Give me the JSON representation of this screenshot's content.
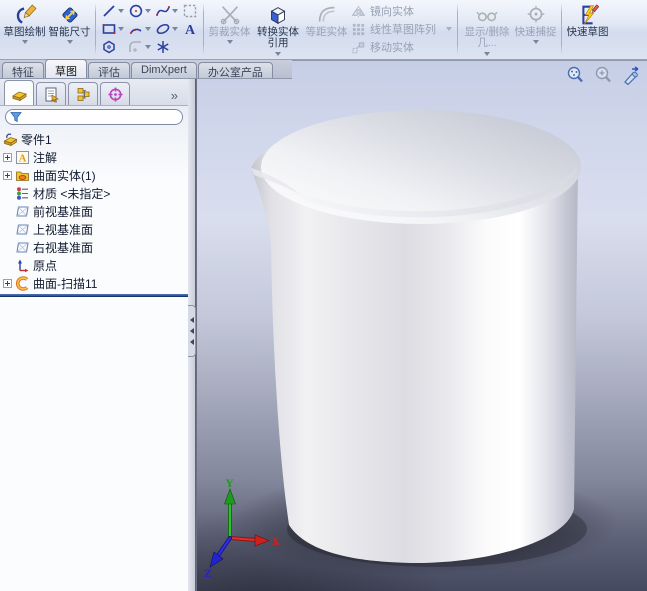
{
  "toolbar": {
    "sketch": "草图绘制",
    "smart_dimension": "智能尺寸",
    "trim": "剪裁实体",
    "convert_entities": "转换实体引用",
    "offset_entities": "等距实体",
    "mirror_entities": "镜向实体",
    "linear_pattern": "线性草图阵列",
    "move_entities": "移动实体",
    "display_delete_relations": "显示/删除几...",
    "quick_snaps": "快速捕捉",
    "rapid_sketch": "快速草图"
  },
  "command_tabs": {
    "items": [
      "特征",
      "草图",
      "评估",
      "DimXpert",
      "办公室产品"
    ],
    "active": "草图"
  },
  "panel": {
    "overflow_chevron": "»",
    "filter_value": "",
    "header_icons": [
      "featuremanager-tree-icon",
      "propertymanager-icon",
      "configurationmanager-icon",
      "dimxpertmanager-icon"
    ]
  },
  "feature_tree": {
    "items": [
      {
        "label": "零件1",
        "icon": "part-icon",
        "expandable": false
      },
      {
        "label": "注解",
        "icon": "annotations-icon",
        "expandable": true
      },
      {
        "label": "曲面实体(1)",
        "icon": "surface-bodies-folder-icon",
        "expandable": true
      },
      {
        "label": "材质 <未指定>",
        "icon": "material-icon",
        "expandable": false
      },
      {
        "label": "前视基准面",
        "icon": "plane-icon",
        "expandable": false
      },
      {
        "label": "上视基准面",
        "icon": "plane-icon",
        "expandable": false
      },
      {
        "label": "右视基准面",
        "icon": "plane-icon",
        "expandable": false
      },
      {
        "label": "原点",
        "icon": "origin-icon",
        "expandable": false
      },
      {
        "label": "曲面-扫描11",
        "icon": "surface-sweep-icon",
        "expandable": true
      }
    ]
  },
  "viewport": {
    "heads_up_icons": [
      "zoom-to-fit-icon",
      "zoom-to-area-icon",
      "view-previous-icon"
    ],
    "model": "beaker-surface-model",
    "triad": {
      "x_label": "X",
      "y_label": "Y",
      "z_label": "Z"
    },
    "triad_colors": {
      "x": "#cf2020",
      "y": "#1d9b1d",
      "z": "#2424cf"
    }
  },
  "colors": {
    "icon_blue": "#2b3f9e",
    "rollback_bar": "#2c4f97",
    "viewport_top": "#c6cee6",
    "viewport_bottom": "#45495f",
    "toolbar_bg": "#dde3f1"
  }
}
